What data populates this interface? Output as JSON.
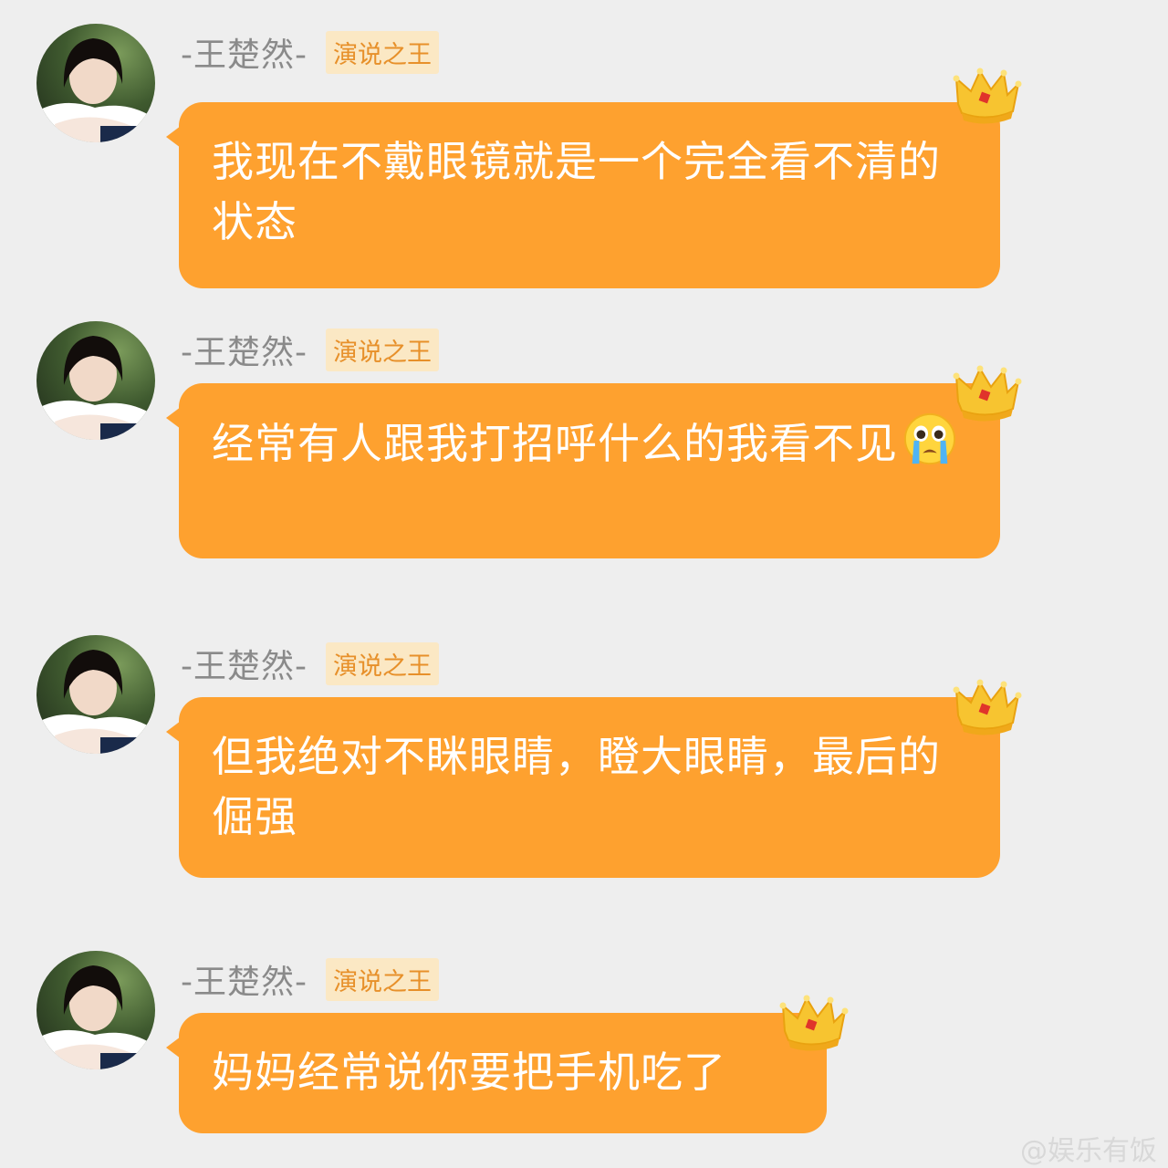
{
  "messages": [
    {
      "name": "-王楚然-",
      "badge": "演说之王",
      "text": "我现在不戴眼镜就是一个完全看不清的状态",
      "emoji": null
    },
    {
      "name": "-王楚然-",
      "badge": "演说之王",
      "text": "经常有人跟我打招呼什么的我看不见",
      "emoji": "crying-face-emoji"
    },
    {
      "name": "-王楚然-",
      "badge": "演说之王",
      "text": "但我绝对不眯眼睛，瞪大眼睛，最后的倔强",
      "emoji": null
    },
    {
      "name": "-王楚然-",
      "badge": "演说之王",
      "text": "妈妈经常说你要把手机吃了",
      "emoji": null
    }
  ],
  "watermark": "@娱乐有饭",
  "colors": {
    "background": "#eeeeee",
    "bubble": "#fea12f",
    "badge_bg": "#fbe8c4",
    "badge_text": "#e7902a",
    "name_text": "#8a8a8a"
  }
}
